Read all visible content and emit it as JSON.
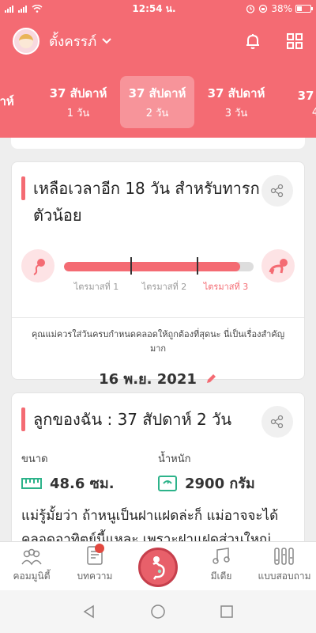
{
  "status_bar": {
    "time": "12:54 น.",
    "battery": "38%",
    "battery_level": 0.38
  },
  "header": {
    "user_name": "ตั้งครรภ์"
  },
  "week_tabs": [
    {
      "week": "ปดาห์",
      "day": ""
    },
    {
      "week": "37 สัปดาห์",
      "day": "1 วัน"
    },
    {
      "week": "37 สัปดาห์",
      "day": "2 วัน",
      "active": true
    },
    {
      "week": "37 สัปดาห์",
      "day": "3 วัน"
    },
    {
      "week": "37 สัป",
      "day": "4"
    }
  ],
  "countdown_card": {
    "title": "เหลือเวลาอีก 18 วัน สำหรับทารกตัวน้อย",
    "progress": 0.93,
    "trimesters": [
      "ไตรมาสที่ 1",
      "ไตรมาสที่ 2",
      "ไตรมาสที่ 3"
    ],
    "note": "คุณแม่ควรใส่วันครบกำหนดคลอดให้ถูกต้องที่สุดนะ นี่เป็นเรื่องสำคัญมาก",
    "due_date": "16 พ.ย. 2021"
  },
  "baby_card": {
    "title": "ลูกของฉัน : 37 สัปดาห์ 2  วัน",
    "size_label": "ขนาด",
    "size_value": "48.6 ซม.",
    "weight_label": "น้ำหนัก",
    "weight_value": "2900 กรัม",
    "description": "แม่รู้มั้ยว่า ถ้าหนูเป็นฝาแฝดล่ะก็ แม่อาจจะได้คลอดอาทิตย์นี้แหละ เพราะฝาแฝดส่วนใหญ่"
  },
  "bottom_nav": {
    "community": "คอมมูนิตี้",
    "articles": "บทความ",
    "media": "มีเดีย",
    "quiz": "แบบสอบถาม"
  },
  "colors": {
    "brand": "#f46b73",
    "accent_green": "#2db38a"
  }
}
